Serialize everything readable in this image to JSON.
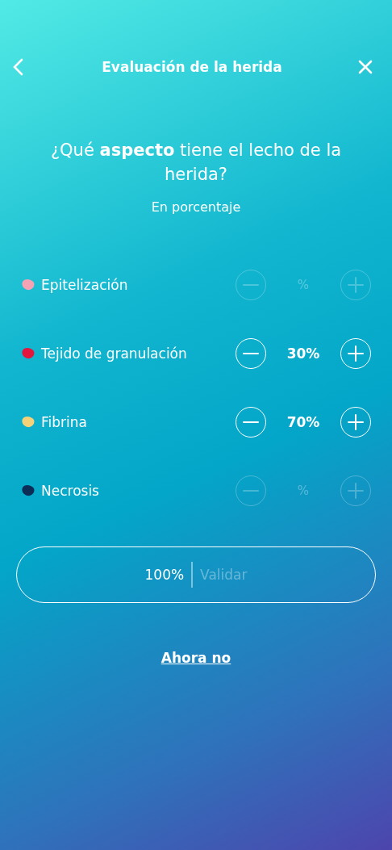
{
  "header": {
    "title": "Evaluación de la herida"
  },
  "question": "¿Qué **aspecto** tiene el lecho de la herida?",
  "subtitle": "En porcentaje",
  "tissues": [
    {
      "name": "Epitelización",
      "color": "#f4a3b4",
      "value": "%",
      "disabled": true
    },
    {
      "name": "Tejido de granulación",
      "color": "#e3173e",
      "value": "30%",
      "disabled": false
    },
    {
      "name": "Fibrina",
      "color": "#f3d27a",
      "value": "70%",
      "disabled": false
    },
    {
      "name": "Necrosis",
      "color": "#0c2d55",
      "value": "%",
      "disabled": true
    }
  ],
  "validate": {
    "total": "100%",
    "label": "Validar",
    "disabled": true
  },
  "skip_link": "Ahora no"
}
